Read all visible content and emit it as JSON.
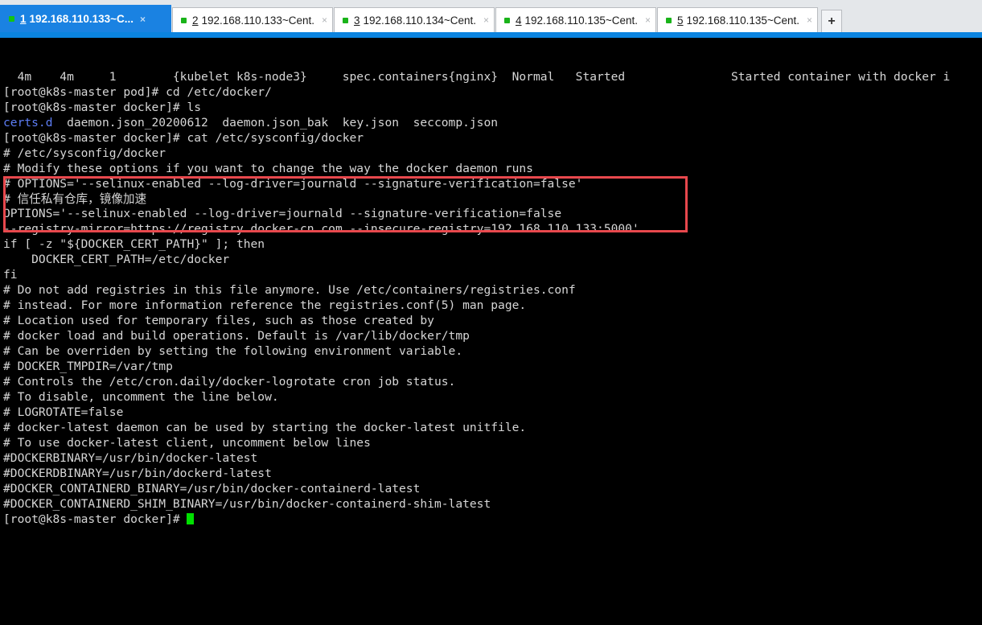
{
  "window": {
    "app": "xshell-terminal",
    "accent_blue": "#0b84e0",
    "active_tab_bg": "#1a82e2",
    "terminal_bg": "#000000",
    "terminal_fg": "#d6d6d6",
    "highlight_color": "#e8484d",
    "cursor_color": "#00e000",
    "dir_color": "#5d7df5"
  },
  "tabs": [
    {
      "index": "1",
      "title": "192.168.110.133~C...",
      "active": true,
      "close_label": "×",
      "status_dot": "connected"
    },
    {
      "index": "2",
      "title": "192.168.110.133~Cent...",
      "active": false,
      "close_label": "×",
      "status_dot": "connected"
    },
    {
      "index": "3",
      "title": "192.168.110.134~Cent...",
      "active": false,
      "close_label": "×",
      "status_dot": "connected"
    },
    {
      "index": "4",
      "title": "192.168.110.135~Cent...",
      "active": false,
      "close_label": "×",
      "status_dot": "connected"
    },
    {
      "index": "5",
      "title": "192.168.110.135~Cent...",
      "active": false,
      "close_label": "×",
      "status_dot": "connected"
    }
  ],
  "new_tab_button": "+",
  "terminal": {
    "lines": [
      "  4m    4m     1        {kubelet k8s-node3}     spec.containers{nginx}  Normal   Started               Started container with docker i",
      "[root@k8s-master pod]# cd /etc/docker/",
      "[root@k8s-master docker]# ls",
      "__LS_OUTPUT__",
      "[root@k8s-master docker]# cat /etc/sysconfig/docker",
      "# /etc/sysconfig/docker",
      "",
      "# Modify these options if you want to change the way the docker daemon runs",
      "# OPTIONS='--selinux-enabled --log-driver=journald --signature-verification=false'",
      "# 信任私有仓库，镜像加速",
      "OPTIONS='--selinux-enabled --log-driver=journald --signature-verification=false",
      "--registry-mirror=https://registry.docker-cn.com --insecure-registry=192.168.110.133:5000'",
      "",
      "",
      "",
      "if [ -z \"${DOCKER_CERT_PATH}\" ]; then",
      "    DOCKER_CERT_PATH=/etc/docker",
      "fi",
      "",
      "# Do not add registries in this file anymore. Use /etc/containers/registries.conf",
      "# instead. For more information reference the registries.conf(5) man page.",
      "",
      "# Location used for temporary files, such as those created by",
      "# docker load and build operations. Default is /var/lib/docker/tmp",
      "# Can be overriden by setting the following environment variable.",
      "# DOCKER_TMPDIR=/var/tmp",
      "",
      "# Controls the /etc/cron.daily/docker-logrotate cron job status.",
      "# To disable, uncomment the line below.",
      "# LOGROTATE=false",
      "",
      "# docker-latest daemon can be used by starting the docker-latest unitfile.",
      "# To use docker-latest client, uncomment below lines",
      "#DOCKERBINARY=/usr/bin/docker-latest",
      "#DOCKERDBINARY=/usr/bin/dockerd-latest",
      "#DOCKER_CONTAINERD_BINARY=/usr/bin/docker-containerd-latest",
      "#DOCKER_CONTAINERD_SHIM_BINARY=/usr/bin/docker-containerd-shim-latest",
      "__PROMPT_LAST__"
    ],
    "ls_output": {
      "directory": "certs.d",
      "files": "  daemon.json_20200612  daemon.json_bak  key.json  seccomp.json"
    },
    "last_prompt": "[root@k8s-master docker]# ",
    "cursor": "block"
  },
  "highlight": {
    "label": "red-annotation-box",
    "content_lines": [
      "# 信任私有仓库，镜像加速",
      "OPTIONS='--selinux-enabled --log-driver=journald --signature-verification=false",
      "--registry-mirror=https://registry.docker-cn.com --insecure-registry=192.168.110.133:5000'"
    ]
  }
}
